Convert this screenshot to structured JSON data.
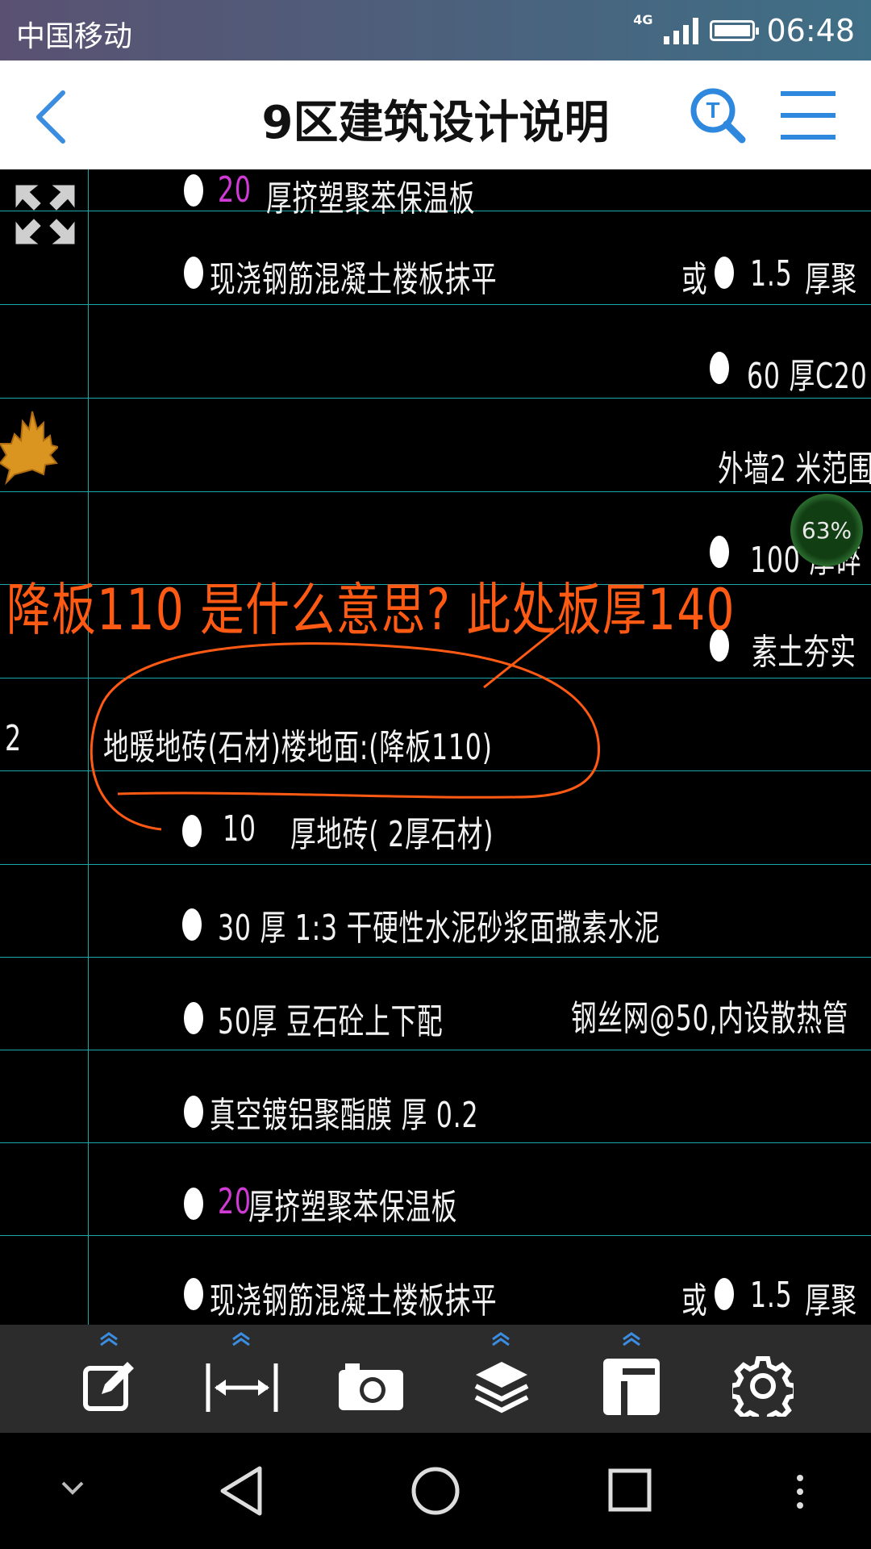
{
  "status_bar": {
    "carrier": "中国移动",
    "network": "4G",
    "time": "06:48"
  },
  "app_bar": {
    "title": "9区建筑设计说明",
    "back_icon": "back-chevron-icon",
    "search_icon": "text-search-icon",
    "menu_icon": "hamburger-menu-icon"
  },
  "drawing": {
    "rows": {
      "r0_num": "20",
      "r0_text": "厚挤塑聚苯保温板",
      "r1_text": "现浇钢筋混凝土楼板抹平",
      "r1_or": "或",
      "r1_right_num": "1.5",
      "r1_right_text": "厚聚",
      "r2_right": "60 厚C20",
      "r3_right": "外墙2 米范围",
      "r4_right": "100  厚碎",
      "r5_right": "素土夯实",
      "section_num": "2",
      "section_title": "地暖地砖(石材)楼地面:(降板110)",
      "l1_num": "10",
      "l1_text": "厚地砖(      2厚石材)",
      "l2_text": "30 厚 1:3  干硬性水泥砂浆面撒素水泥",
      "l3_text": "50厚    豆石砼上下配",
      "l3_overlap": "钢丝网@50,内设散热管",
      "l4_text": "真空镀铝聚酯膜    厚  0.2",
      "l5_num": "20",
      "l5_text": "厚挤塑聚苯保温板",
      "l6_text": "现浇钢筋混凝土楼板抹平",
      "l6_or": "或",
      "l6_right_num": "1.5",
      "l6_right_text": "厚聚"
    },
    "annotation": "降板110 是什么意思? 此处板厚140",
    "zoom_percent": "63%",
    "expand_icon": "expand-arrows-icon",
    "leaf_icon": "maple-leaf-icon",
    "annotation_color": "#ff5a14",
    "grid_color": "#1aa7a7"
  },
  "toolbar": {
    "items": [
      "edit-icon",
      "measure-icon",
      "camera-icon",
      "layers-icon",
      "layout-icon",
      "settings-icon"
    ]
  },
  "nav_bar": {
    "items": [
      "collapse-chevron-icon",
      "back-triangle-icon",
      "home-circle-icon",
      "recents-square-icon",
      "more-dots-icon"
    ]
  }
}
